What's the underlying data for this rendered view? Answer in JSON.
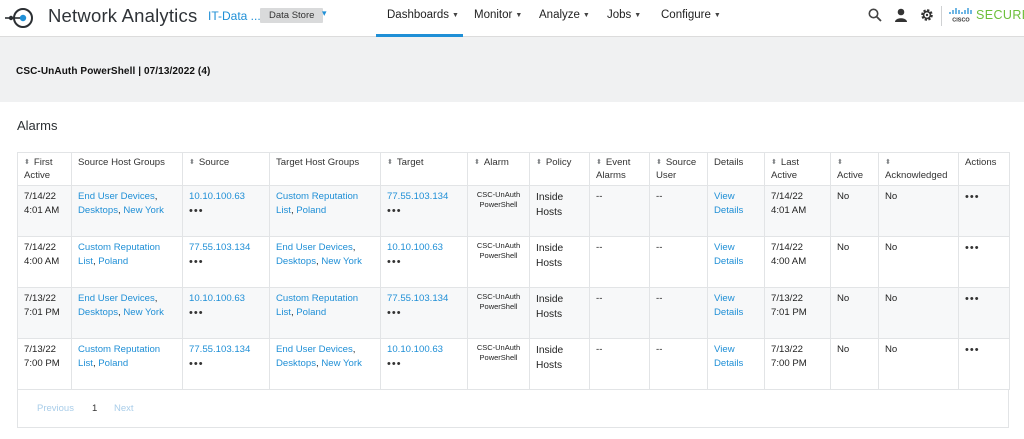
{
  "header": {
    "app_title": "Network Analytics",
    "domain_link": "IT-Data ...",
    "domain_chip": "Data Store",
    "domain_caret": "▾",
    "nav": [
      {
        "label": "Dashboards",
        "active": true
      },
      {
        "label": "Monitor"
      },
      {
        "label": "Analyze"
      },
      {
        "label": "Jobs"
      },
      {
        "label": "Configure"
      }
    ],
    "brand_text": "SECURE",
    "accent_color": "#1f8fd6",
    "brand_color": "#6cbf3a",
    "icons": [
      "search-icon",
      "user-icon",
      "gear-icon",
      "cisco-logo"
    ]
  },
  "page": {
    "title": "CSC-UnAuth PowerShell | 07/13/2022 (4)",
    "section_heading": "Alarms"
  },
  "table": {
    "columns": [
      "First Active",
      "Source Host Groups",
      "Source",
      "Target Host Groups",
      "Target",
      "Alarm",
      "Policy",
      "Event Alarms",
      "Source User",
      "Details",
      "Last Active",
      "Active",
      "Acknowledged",
      "Actions"
    ],
    "rows": [
      {
        "first_active": "7/14/22 4:01 AM",
        "source_groups": [
          {
            "text": "End User Devices",
            "link": true
          },
          {
            "text": ", ",
            "link": false
          },
          {
            "text": "Desktops",
            "link": true
          },
          {
            "text": ", ",
            "link": false
          },
          {
            "text": "New York",
            "link": true
          }
        ],
        "source": "10.10.100.63",
        "target_groups": [
          {
            "text": "Custom Reputation List",
            "link": true
          },
          {
            "text": ", ",
            "link": false
          },
          {
            "text": "Poland",
            "link": true
          }
        ],
        "target": "77.55.103.134",
        "alarm": "CSC-UnAuth PowerShell",
        "policy": "Inside Hosts",
        "event_alarms": "--",
        "source_user": "--",
        "details": "View Details",
        "last_active": "7/14/22 4:01 AM",
        "active": "No",
        "acknowledged": "No",
        "actions": "•••"
      },
      {
        "first_active": "7/14/22 4:00 AM",
        "source_groups": [
          {
            "text": "Custom Reputation List",
            "link": true
          },
          {
            "text": ", ",
            "link": false
          },
          {
            "text": "Poland",
            "link": true
          }
        ],
        "source": "77.55.103.134",
        "target_groups": [
          {
            "text": "End User Devices",
            "link": true
          },
          {
            "text": ", ",
            "link": false
          },
          {
            "text": "Desktops",
            "link": true
          },
          {
            "text": ", ",
            "link": false
          },
          {
            "text": "New York",
            "link": true
          }
        ],
        "target": "10.10.100.63",
        "alarm": "CSC-UnAuth PowerShell",
        "policy": "Inside Hosts",
        "event_alarms": "--",
        "source_user": "--",
        "details": "View Details",
        "last_active": "7/14/22 4:00 AM",
        "active": "No",
        "acknowledged": "No",
        "actions": "•••"
      },
      {
        "first_active": "7/13/22 7:01 PM",
        "source_groups": [
          {
            "text": "End User Devices",
            "link": true
          },
          {
            "text": ", ",
            "link": false
          },
          {
            "text": "Desktops",
            "link": true
          },
          {
            "text": ", ",
            "link": false
          },
          {
            "text": "New York",
            "link": true
          }
        ],
        "source": "10.10.100.63",
        "target_groups": [
          {
            "text": "Custom Reputation List",
            "link": true
          },
          {
            "text": ", ",
            "link": false
          },
          {
            "text": "Poland",
            "link": true
          }
        ],
        "target": "77.55.103.134",
        "alarm": "CSC-UnAuth PowerShell",
        "policy": "Inside Hosts",
        "event_alarms": "--",
        "source_user": "--",
        "details": "View Details",
        "last_active": "7/13/22 7:01 PM",
        "active": "No",
        "acknowledged": "No",
        "actions": "•••"
      },
      {
        "first_active": "7/13/22 7:00 PM",
        "source_groups": [
          {
            "text": "Custom Reputation List",
            "link": true
          },
          {
            "text": ", ",
            "link": false
          },
          {
            "text": "Poland",
            "link": true
          }
        ],
        "source": "77.55.103.134",
        "target_groups": [
          {
            "text": "End User Devices",
            "link": true
          },
          {
            "text": ", ",
            "link": false
          },
          {
            "text": "Desktops",
            "link": true
          },
          {
            "text": ", ",
            "link": false
          },
          {
            "text": "New York",
            "link": true
          }
        ],
        "target": "10.10.100.63",
        "alarm": "CSC-UnAuth PowerShell",
        "policy": "Inside Hosts",
        "event_alarms": "--",
        "source_user": "--",
        "details": "View Details",
        "last_active": "7/13/22 7:00 PM",
        "active": "No",
        "acknowledged": "No",
        "actions": "•••"
      }
    ],
    "ip_actions": "•••",
    "sort_glyph": "⬍"
  },
  "pagination": {
    "previous": "Previous",
    "current_page": "1",
    "next": "Next"
  }
}
